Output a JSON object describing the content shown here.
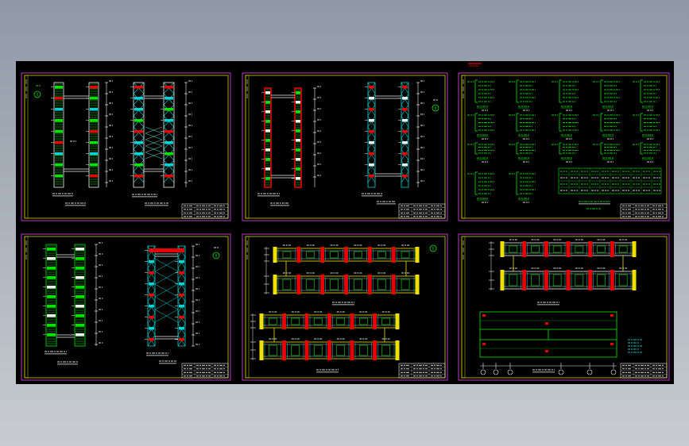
{
  "colors": {
    "background_top": "#8f99a6",
    "background_bottom": "#c8ccd1",
    "canvas": "#000000",
    "sheet_border": "#a030a0",
    "sheet_frame": "#d4d400",
    "white": "#f2f2f2",
    "green": "#00e600",
    "cyan": "#00d4d4",
    "red": "#e80000",
    "yellow": "#f0e000"
  }
}
